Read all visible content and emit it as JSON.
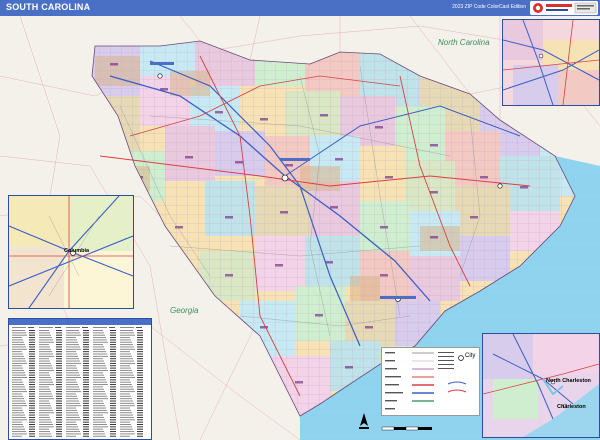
{
  "map": {
    "title": "SOUTH CAROLINA",
    "edition": "2023 ZIP Code ColorCast Edition",
    "neighbor_labels": {
      "north_carolina": "North Carolina",
      "georgia": "Georgia"
    },
    "inset_cities": {
      "columbia": "Columbia",
      "north_charleston": "North Charleston",
      "charleston": "Charleston"
    },
    "legend": {
      "city_label": "City"
    },
    "colors": {
      "title_bar": "#4a70c6",
      "ocean": "#8fd3ee",
      "surrounding_land": "#f4f1ea",
      "zip_fill_palette": [
        "#e9c9de",
        "#c7e9f3",
        "#f6e2b4",
        "#d8ccec",
        "#cfeecf",
        "#f3c9c3",
        "#e6d9b6",
        "#bfe3e8",
        "#f2d3e8",
        "#d9e7c4"
      ],
      "highway_red": "#d94040",
      "highway_blue": "#3a5fc8"
    },
    "icons": [
      "north-arrow-icon",
      "publisher-logo"
    ]
  }
}
